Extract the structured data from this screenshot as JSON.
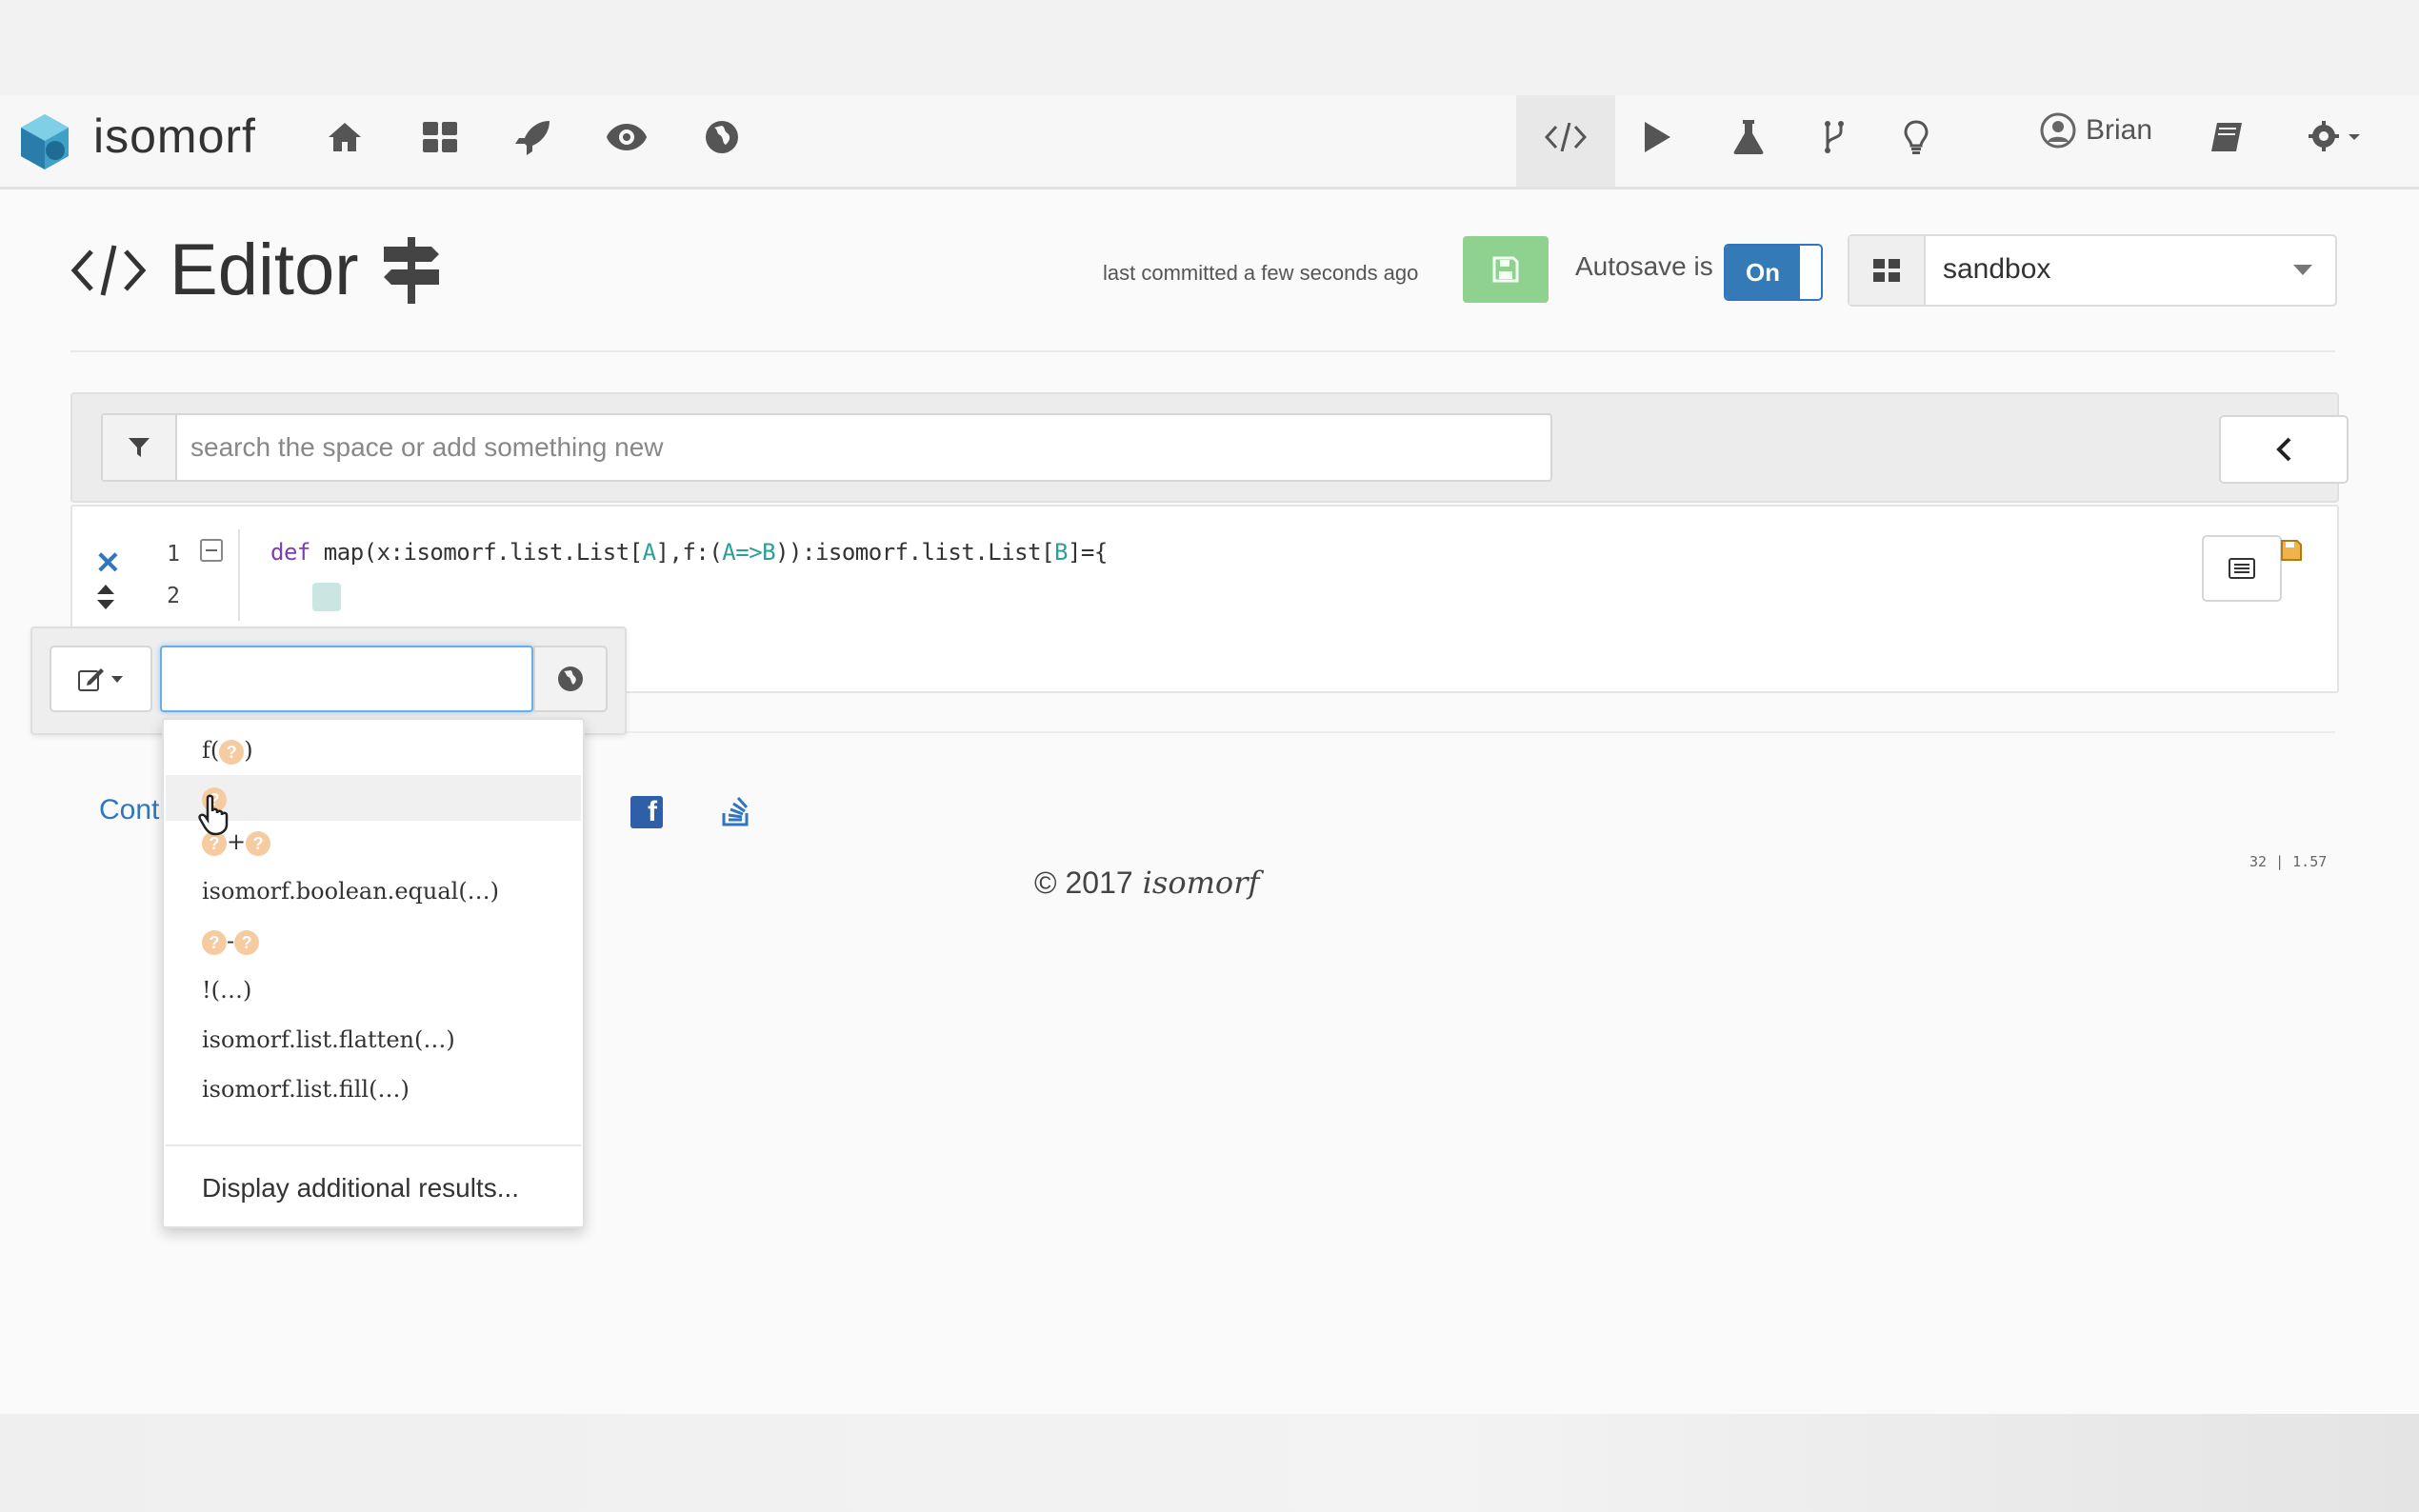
{
  "app": {
    "brand": "isomorf",
    "user": "Brian"
  },
  "nav": {
    "items": [
      "home-icon",
      "dashboard-icon",
      "rocket-icon",
      "eye-icon",
      "globe-icon"
    ],
    "right_items": [
      "code-icon",
      "play-icon",
      "flask-icon",
      "branch-icon",
      "lightbulb-icon"
    ]
  },
  "header": {
    "title": "Editor",
    "commit_status": "last committed a few seconds ago",
    "autosave_label": "Autosave is",
    "autosave_state": "On",
    "space": "sandbox"
  },
  "search": {
    "placeholder": "search the space or add something new"
  },
  "editor": {
    "line_numbers": [
      "1",
      "2"
    ],
    "line1": {
      "kw": "def",
      "p1": " map(x:isomorf.list.List[",
      "a": "A",
      "p2": "],f:(",
      "ab": "A=>B",
      "p3": ")):isomorf.list.List[",
      "b": "B",
      "p4": "]={"
    }
  },
  "popup": {
    "input_value": "",
    "suggestions": {
      "s0": "f(",
      "s0_end": ")",
      "s2_op": "+",
      "s3": "isomorf.boolean.equal(…)",
      "s4_op": "-",
      "s5": "!(…)",
      "s6": "isomorf.list.flatten(…)",
      "s7": "isomorf.list.fill(…)"
    },
    "hole_glyph": "?",
    "more": "Display additional results..."
  },
  "footer": {
    "contact": "Cont",
    "copyright": "© 2017",
    "brand": "isomorf",
    "version": "32 | 1.57"
  },
  "colors": {
    "accent": "#337ab7",
    "save": "#8fd18f",
    "hole": "#f6cba0"
  }
}
